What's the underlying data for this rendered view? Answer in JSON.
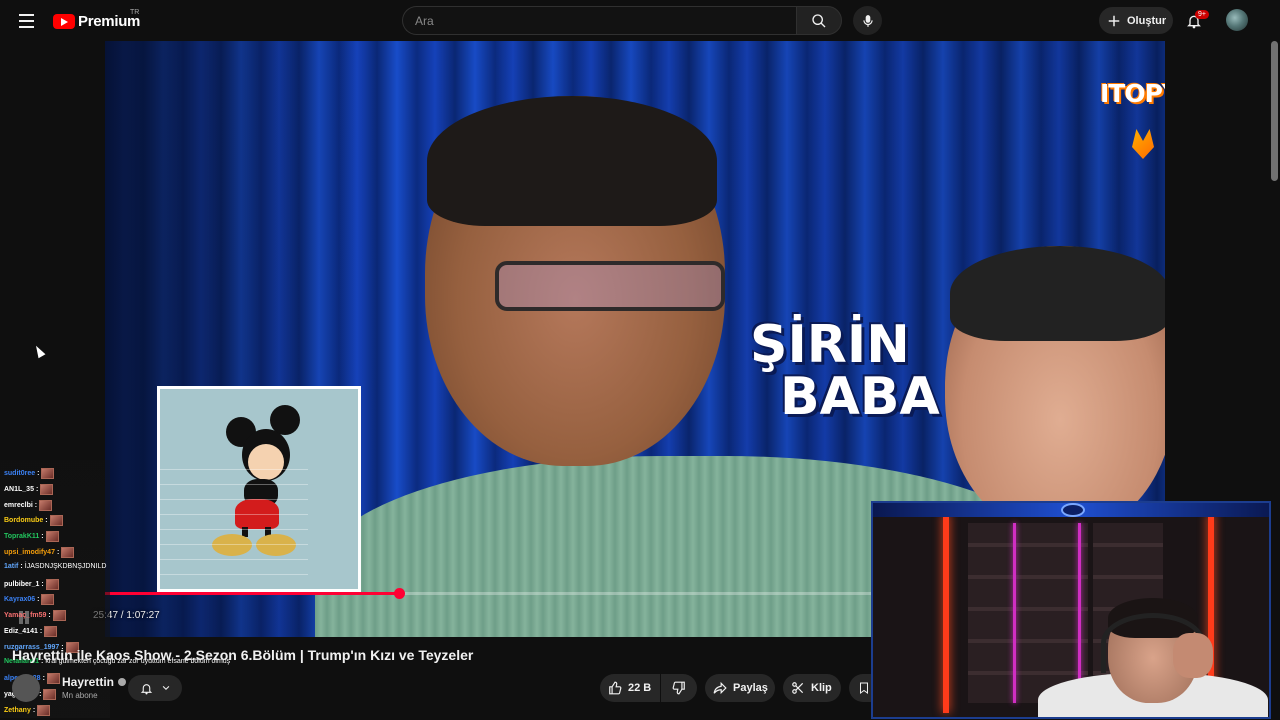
{
  "header": {
    "logo_text": "Premium",
    "region_code": "TR",
    "search_placeholder": "Ara",
    "create_label": "Oluştur",
    "notification_count": "9+"
  },
  "video": {
    "overlay_line1": "ŞİRİN",
    "overlay_line2": "BABA",
    "watermark": "ITOPYA.COM",
    "current_time": "25:47 / 1:07:27",
    "progress_fraction": 0.3823
  },
  "info": {
    "title": "Hayrettin ile Kaos Show - 2.Sezon 6.Bölüm | Trump'ın Kızı ve Teyzeler",
    "channel_name": "Hayrettin",
    "subscribers": "Mn abone",
    "like_count": "22 B",
    "share_label": "Paylaş",
    "clip_label": "Klip"
  },
  "chat": [
    {
      "user": "sudit0ree",
      "color": "#3b82f6",
      "msg": ""
    },
    {
      "user": "AN1L_35",
      "color": "#ffffff",
      "msg": ""
    },
    {
      "user": "emreclbi",
      "color": "#ffffff",
      "msg": ""
    },
    {
      "user": "Bordomube",
      "color": "#facc15",
      "msg": ""
    },
    {
      "user": "ToprakK11",
      "color": "#22c55e",
      "msg": ""
    },
    {
      "user": "upsi_imodify47",
      "color": "#f59e0b",
      "msg": ""
    },
    {
      "user": "1atif",
      "color": "#60a5fa",
      "msg": "İJASDNJŞKDBNŞJDNILD"
    },
    {
      "user": "pulbiber_1",
      "color": "#ffffff",
      "msg": ""
    },
    {
      "user": "Kayrax06",
      "color": "#3b82f6",
      "msg": ""
    },
    {
      "user": "Yamaç_fm59",
      "color": "#f87171",
      "msg": ""
    },
    {
      "user": "Ediz_4141",
      "color": "#ffffff",
      "msg": ""
    },
    {
      "user": "ruzgarrass_1997",
      "color": "#60a5fa",
      "msg": ""
    },
    {
      "user": "Nefalian61",
      "color": "#22c55e",
      "msg": "kral gülmekten çocuğu zar zor uyuttum efsane bölüm olmuş"
    },
    {
      "user": "alpereen28",
      "color": "#3b82f6",
      "msg": ""
    },
    {
      "user": "yagiz2121",
      "color": "#ffffff",
      "msg": ""
    },
    {
      "user": "Zethany",
      "color": "#facc15",
      "msg": ""
    }
  ],
  "icons": {
    "menu": "menu-icon",
    "search": "search-icon",
    "mic": "mic-icon",
    "create": "plus-icon",
    "bell": "bell-icon",
    "like": "thumbs-up-icon",
    "dislike": "thumbs-down-icon",
    "share": "share-icon",
    "clip": "scissors-icon",
    "save": "bookmark-icon"
  },
  "colors": {
    "accent": "#ff0033",
    "background": "#0f0f0f"
  }
}
